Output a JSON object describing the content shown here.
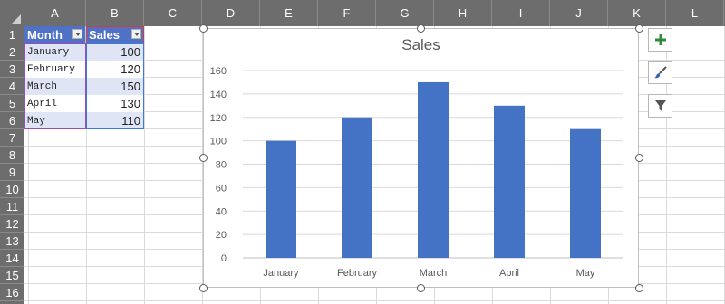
{
  "columns": [
    "A",
    "B",
    "C",
    "D",
    "E",
    "F",
    "G",
    "H",
    "I",
    "J",
    "K",
    "L"
  ],
  "rows": [
    "1",
    "2",
    "3",
    "4",
    "5",
    "6",
    "7",
    "8",
    "9",
    "10",
    "11",
    "12",
    "13",
    "14",
    "15",
    "16"
  ],
  "table": {
    "headers": [
      "Month",
      "Sales"
    ],
    "rows": [
      {
        "month": "January",
        "sales": "100"
      },
      {
        "month": "February",
        "sales": "120"
      },
      {
        "month": "March",
        "sales": "150"
      },
      {
        "month": "April",
        "sales": "130"
      },
      {
        "month": "May",
        "sales": "110"
      }
    ]
  },
  "side_buttons": {
    "add": "plus-icon",
    "style": "brush-icon",
    "filter": "filter-icon"
  },
  "colors": {
    "bar": "#4472c4",
    "header_fill": "#4f72c6",
    "table_band": "#dfe5f5"
  },
  "chart_data": {
    "type": "bar",
    "title": "Sales",
    "categories": [
      "January",
      "February",
      "March",
      "April",
      "May"
    ],
    "values": [
      100,
      120,
      150,
      130,
      110
    ],
    "ylim": [
      0,
      160
    ],
    "yticks": [
      0,
      20,
      40,
      60,
      80,
      100,
      120,
      140,
      160
    ],
    "grid": true,
    "legend": "none"
  }
}
